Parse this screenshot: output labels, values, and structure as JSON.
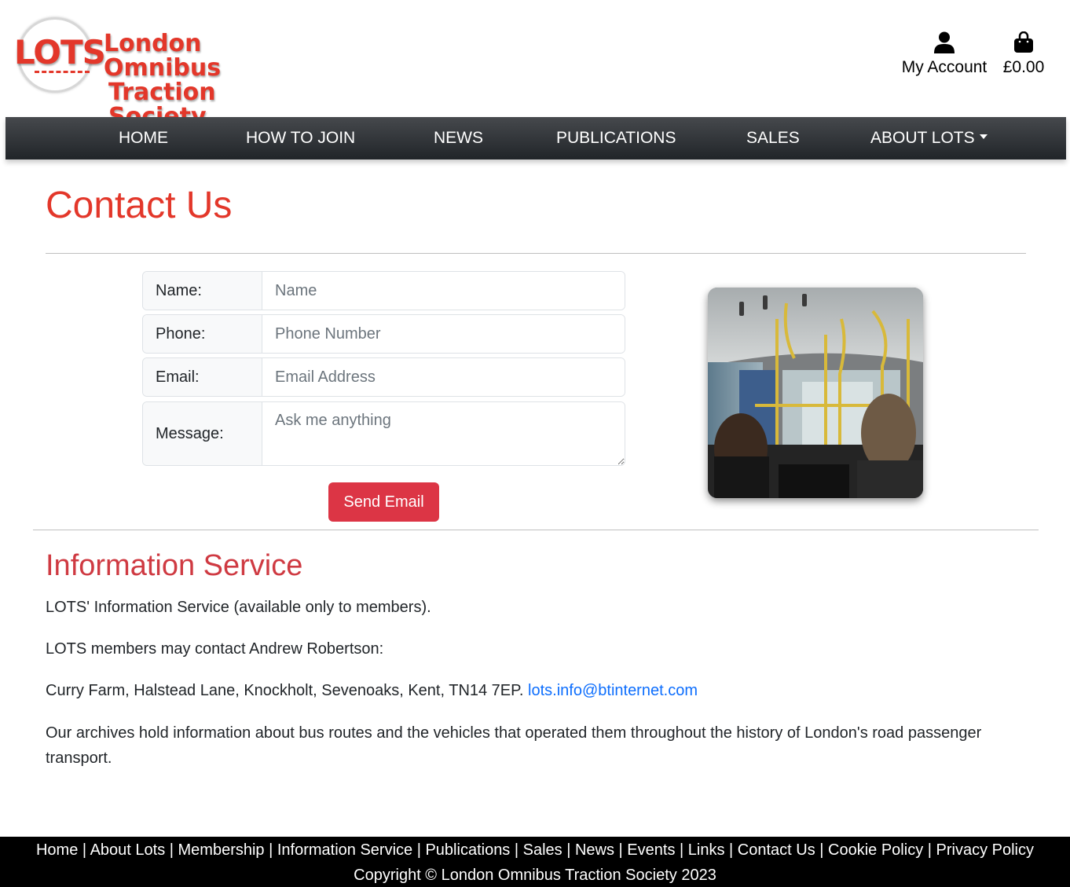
{
  "header": {
    "logo_text": "LOTS",
    "org_name_line1": "London Omnibus",
    "org_name_line2": "Traction Society",
    "account_label": "My Account",
    "cart_total": "£0.00"
  },
  "nav": {
    "items": [
      {
        "label": "HOME"
      },
      {
        "label": "HOW TO JOIN"
      },
      {
        "label": "NEWS"
      },
      {
        "label": "PUBLICATIONS"
      },
      {
        "label": "SALES"
      },
      {
        "label": "ABOUT LOTS"
      }
    ]
  },
  "contact": {
    "title": "Contact Us",
    "form": {
      "name_label": "Name:",
      "name_placeholder": "Name",
      "phone_label": "Phone:",
      "phone_placeholder": "Phone Number",
      "email_label": "Email:",
      "email_placeholder": "Email Address",
      "message_label": "Message:",
      "message_placeholder": "Ask me anything",
      "submit_label": "Send Email"
    }
  },
  "info": {
    "title": "Information Service",
    "p1": "LOTS' Information Service (available only to members).",
    "p2": "LOTS members may contact Andrew Robertson:",
    "p3": "Curry Farm, Halstead Lane, Knockholt, Sevenoaks, Kent, TN14 7EP.",
    "email_link": "lots.info@btinternet.com",
    "p4": "Our archives hold information about bus routes and the vehicles that operated them throughout the history of London's road passenger transport."
  },
  "footer": {
    "links": [
      "Home",
      "About Lots",
      "Membership",
      "Information Service",
      "Publications",
      "Sales",
      "News",
      "Events",
      "Links",
      "Contact Us",
      "Cookie Policy",
      "Privacy Policy"
    ],
    "separator": " | ",
    "copyright": "Copyright © London Omnibus Traction Society 2023"
  },
  "colors": {
    "brand_red": "#e3372a",
    "heading_red": "#cf3a42",
    "button_red": "#dc3545",
    "nav_dark": "#212529",
    "link_blue": "#0d6efd"
  },
  "icons": {
    "account": "person-icon",
    "cart": "shopping-bag-icon"
  }
}
